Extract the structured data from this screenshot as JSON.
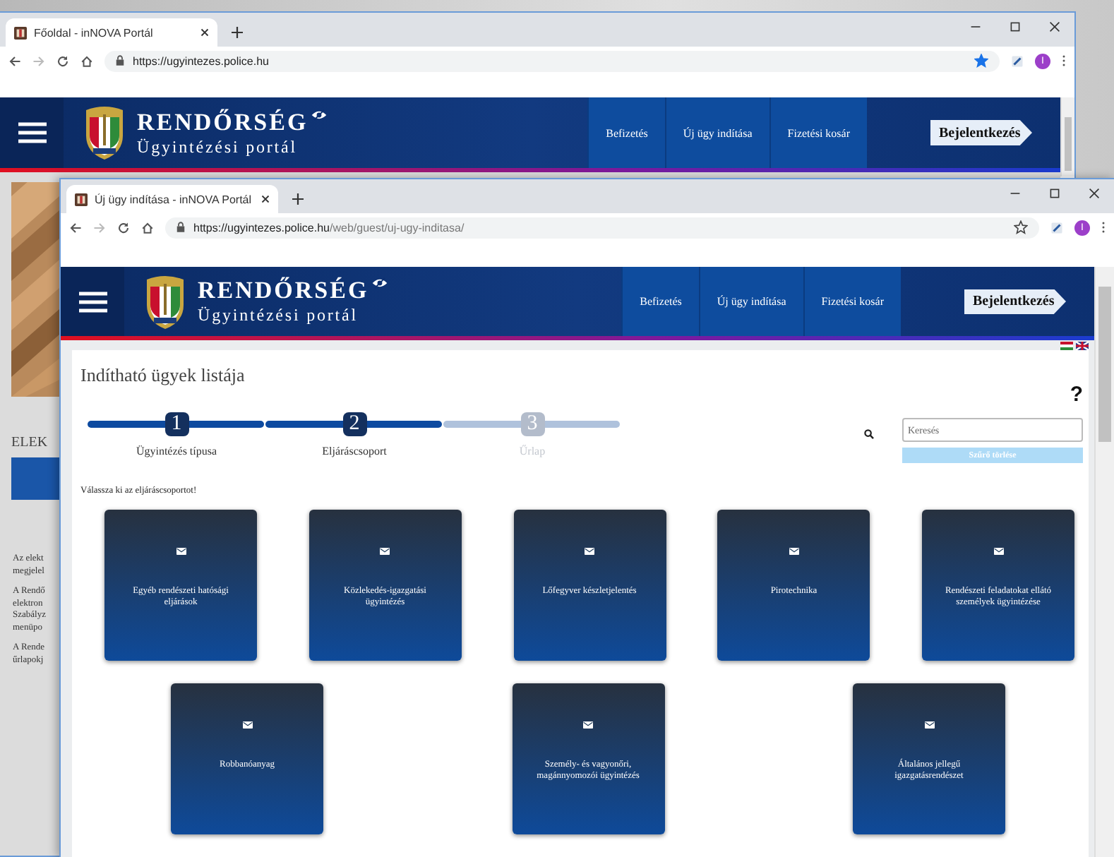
{
  "windows": [
    {
      "kind": "home",
      "tab_title": "Főoldal - inNOVA Portál",
      "url_host": "https://ugyintezes.police.hu",
      "bookmarked": true,
      "avatar": "I",
      "brand": {
        "title": "RENDŐRSÉG",
        "subtitle": "Ügyintézési portál"
      },
      "nav": [
        "Befizetés",
        "Új ügy indítása",
        "Fizetési kosár"
      ],
      "login": "Bejelentkezés",
      "heading": "ELEK",
      "paragraphs": [
        [
          "Az elekt",
          "megjelel"
        ],
        [
          "A Rendő",
          "elektron",
          "Szabályz",
          "menüpo"
        ],
        [
          "A Rende",
          "űrlapokj"
        ]
      ]
    },
    {
      "kind": "new_case",
      "tab_title": "Új ügy indítása - inNOVA Portál",
      "url_host": "https://ugyintezes.police.hu",
      "url_path": "/web/guest/uj-ugy-inditasa/",
      "bookmarked": false,
      "avatar": "I",
      "brand": {
        "title": "RENDŐRSÉG",
        "subtitle": "Ügyintézési portál"
      },
      "nav": [
        "Befizetés",
        "Új ügy indítása",
        "Fizetési kosár"
      ],
      "login": "Bejelentkezés",
      "page_title": "Indítható ügyek listája",
      "help": "?",
      "steps": [
        {
          "number": "1",
          "label": "Ügyintézés típusa",
          "active": true
        },
        {
          "number": "2",
          "label": "Eljáráscsoport",
          "active": true
        },
        {
          "number": "3",
          "label": "Űrlap",
          "active": false
        }
      ],
      "search": {
        "placeholder": "Keresés"
      },
      "clear_button": "Szűrő törlése",
      "instruction": "Válassza ki az eljáráscsoportot!",
      "tile_rows": [
        [
          {
            "label": "Egyéb rendészeti hatósági eljárások"
          },
          {
            "label": "Közlekedés-igazgatási ügyintézés"
          },
          {
            "label": "Lőfegyver készletjelentés"
          },
          {
            "label": "Pirotechnika"
          },
          {
            "label": "Rendészeti feladatokat ellátó személyek ügyintézése"
          }
        ],
        [
          {
            "label": "Robbanóanyag"
          },
          {
            "label": "Személy- és vagyonőri, magánnyomozói ügyintézés"
          },
          {
            "label": "Általános jellegű igazgatásrendészet"
          }
        ]
      ]
    }
  ]
}
